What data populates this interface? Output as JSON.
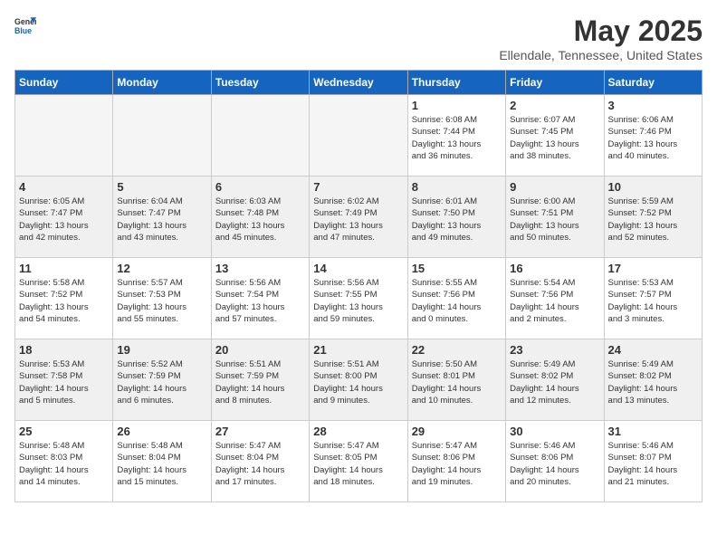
{
  "logo": {
    "general": "General",
    "blue": "Blue"
  },
  "title": "May 2025",
  "subtitle": "Ellendale, Tennessee, United States",
  "headers": [
    "Sunday",
    "Monday",
    "Tuesday",
    "Wednesday",
    "Thursday",
    "Friday",
    "Saturday"
  ],
  "weeks": [
    [
      {
        "date": "",
        "info": ""
      },
      {
        "date": "",
        "info": ""
      },
      {
        "date": "",
        "info": ""
      },
      {
        "date": "",
        "info": ""
      },
      {
        "date": "1",
        "info": "Sunrise: 6:08 AM\nSunset: 7:44 PM\nDaylight: 13 hours\nand 36 minutes."
      },
      {
        "date": "2",
        "info": "Sunrise: 6:07 AM\nSunset: 7:45 PM\nDaylight: 13 hours\nand 38 minutes."
      },
      {
        "date": "3",
        "info": "Sunrise: 6:06 AM\nSunset: 7:46 PM\nDaylight: 13 hours\nand 40 minutes."
      }
    ],
    [
      {
        "date": "4",
        "info": "Sunrise: 6:05 AM\nSunset: 7:47 PM\nDaylight: 13 hours\nand 42 minutes."
      },
      {
        "date": "5",
        "info": "Sunrise: 6:04 AM\nSunset: 7:47 PM\nDaylight: 13 hours\nand 43 minutes."
      },
      {
        "date": "6",
        "info": "Sunrise: 6:03 AM\nSunset: 7:48 PM\nDaylight: 13 hours\nand 45 minutes."
      },
      {
        "date": "7",
        "info": "Sunrise: 6:02 AM\nSunset: 7:49 PM\nDaylight: 13 hours\nand 47 minutes."
      },
      {
        "date": "8",
        "info": "Sunrise: 6:01 AM\nSunset: 7:50 PM\nDaylight: 13 hours\nand 49 minutes."
      },
      {
        "date": "9",
        "info": "Sunrise: 6:00 AM\nSunset: 7:51 PM\nDaylight: 13 hours\nand 50 minutes."
      },
      {
        "date": "10",
        "info": "Sunrise: 5:59 AM\nSunset: 7:52 PM\nDaylight: 13 hours\nand 52 minutes."
      }
    ],
    [
      {
        "date": "11",
        "info": "Sunrise: 5:58 AM\nSunset: 7:52 PM\nDaylight: 13 hours\nand 54 minutes."
      },
      {
        "date": "12",
        "info": "Sunrise: 5:57 AM\nSunset: 7:53 PM\nDaylight: 13 hours\nand 55 minutes."
      },
      {
        "date": "13",
        "info": "Sunrise: 5:56 AM\nSunset: 7:54 PM\nDaylight: 13 hours\nand 57 minutes."
      },
      {
        "date": "14",
        "info": "Sunrise: 5:56 AM\nSunset: 7:55 PM\nDaylight: 13 hours\nand 59 minutes."
      },
      {
        "date": "15",
        "info": "Sunrise: 5:55 AM\nSunset: 7:56 PM\nDaylight: 14 hours\nand 0 minutes."
      },
      {
        "date": "16",
        "info": "Sunrise: 5:54 AM\nSunset: 7:56 PM\nDaylight: 14 hours\nand 2 minutes."
      },
      {
        "date": "17",
        "info": "Sunrise: 5:53 AM\nSunset: 7:57 PM\nDaylight: 14 hours\nand 3 minutes."
      }
    ],
    [
      {
        "date": "18",
        "info": "Sunrise: 5:53 AM\nSunset: 7:58 PM\nDaylight: 14 hours\nand 5 minutes."
      },
      {
        "date": "19",
        "info": "Sunrise: 5:52 AM\nSunset: 7:59 PM\nDaylight: 14 hours\nand 6 minutes."
      },
      {
        "date": "20",
        "info": "Sunrise: 5:51 AM\nSunset: 7:59 PM\nDaylight: 14 hours\nand 8 minutes."
      },
      {
        "date": "21",
        "info": "Sunrise: 5:51 AM\nSunset: 8:00 PM\nDaylight: 14 hours\nand 9 minutes."
      },
      {
        "date": "22",
        "info": "Sunrise: 5:50 AM\nSunset: 8:01 PM\nDaylight: 14 hours\nand 10 minutes."
      },
      {
        "date": "23",
        "info": "Sunrise: 5:49 AM\nSunset: 8:02 PM\nDaylight: 14 hours\nand 12 minutes."
      },
      {
        "date": "24",
        "info": "Sunrise: 5:49 AM\nSunset: 8:02 PM\nDaylight: 14 hours\nand 13 minutes."
      }
    ],
    [
      {
        "date": "25",
        "info": "Sunrise: 5:48 AM\nSunset: 8:03 PM\nDaylight: 14 hours\nand 14 minutes."
      },
      {
        "date": "26",
        "info": "Sunrise: 5:48 AM\nSunset: 8:04 PM\nDaylight: 14 hours\nand 15 minutes."
      },
      {
        "date": "27",
        "info": "Sunrise: 5:47 AM\nSunset: 8:04 PM\nDaylight: 14 hours\nand 17 minutes."
      },
      {
        "date": "28",
        "info": "Sunrise: 5:47 AM\nSunset: 8:05 PM\nDaylight: 14 hours\nand 18 minutes."
      },
      {
        "date": "29",
        "info": "Sunrise: 5:47 AM\nSunset: 8:06 PM\nDaylight: 14 hours\nand 19 minutes."
      },
      {
        "date": "30",
        "info": "Sunrise: 5:46 AM\nSunset: 8:06 PM\nDaylight: 14 hours\nand 20 minutes."
      },
      {
        "date": "31",
        "info": "Sunrise: 5:46 AM\nSunset: 8:07 PM\nDaylight: 14 hours\nand 21 minutes."
      }
    ]
  ]
}
